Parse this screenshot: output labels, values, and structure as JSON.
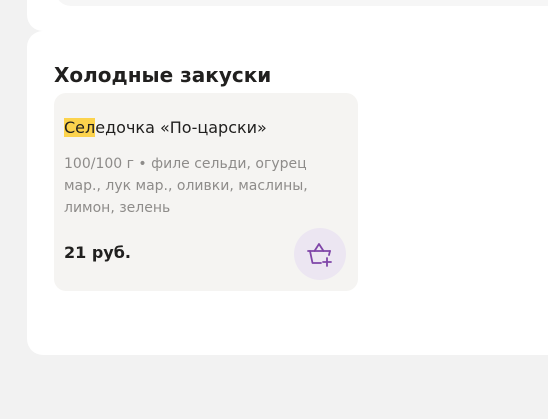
{
  "section": {
    "title": "Холодные закуски"
  },
  "product": {
    "name_highlight": "Сел",
    "name_rest": "едочка «По-царски»",
    "description": "100/100 г • филе сельди, огурец мар., лук мар., оливки, маслины, лимон, зелень",
    "price": "21 руб.",
    "add_icon": "basket-add-icon"
  },
  "colors": {
    "accent": "#7f45a8",
    "highlight": "#fcd34d",
    "card_bg": "#f5f4f2",
    "button_bg": "#ece6f2"
  }
}
